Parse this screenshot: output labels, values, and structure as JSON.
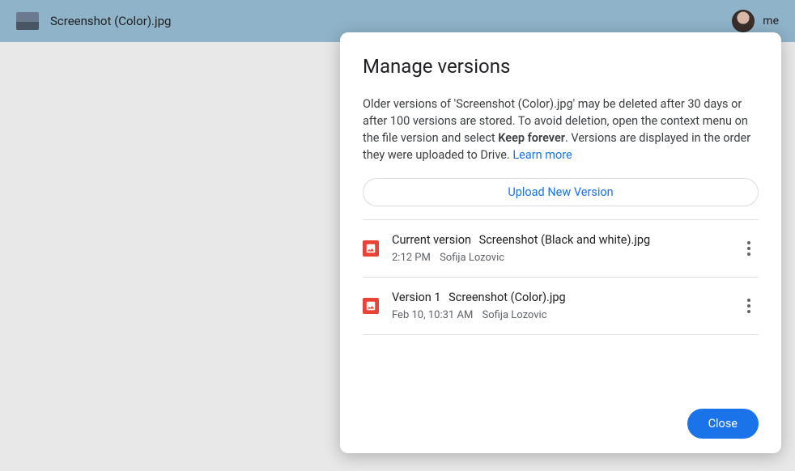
{
  "topbar": {
    "filename": "Screenshot (Color).jpg",
    "owner_label": "me"
  },
  "dialog": {
    "title": "Manage versions",
    "description_part1": "Older versions of 'Screenshot (Color).jpg' may be deleted after 30 days or after 100 versions are stored. To avoid deletion, open the context menu on the file version and select ",
    "description_bold": "Keep forever",
    "description_part2": ". Versions are displayed in the order they were uploaded to Drive. ",
    "learn_more": "Learn more",
    "upload_button": "Upload New Version",
    "close_button": "Close",
    "versions": [
      {
        "label": "Current version",
        "filename": "Screenshot (Black and white).jpg",
        "time": "2:12 PM",
        "author": "Sofija Lozovic"
      },
      {
        "label": "Version 1",
        "filename": "Screenshot (Color).jpg",
        "time": "Feb 10, 10:31 AM",
        "author": "Sofija Lozovic"
      }
    ]
  }
}
